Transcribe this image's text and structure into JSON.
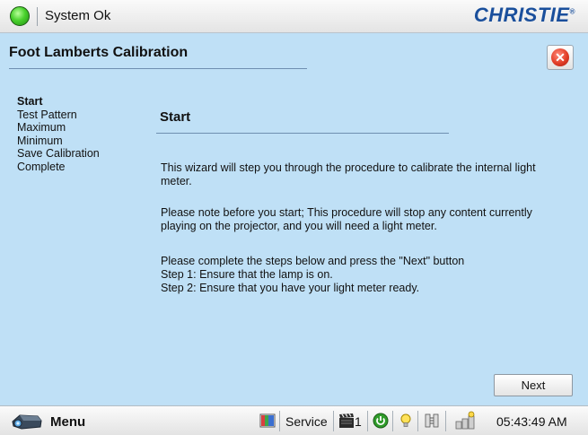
{
  "status": {
    "text": "System Ok",
    "indicator_color": "#3cc421"
  },
  "brand": {
    "name": "CHRISTIE",
    "mark": "®",
    "color": "#1a4f9c"
  },
  "page": {
    "title": "Foot Lamberts Calibration",
    "close_icon": "close-circle-icon"
  },
  "steps": [
    {
      "label": "Start",
      "active": true
    },
    {
      "label": "Test Pattern",
      "active": false
    },
    {
      "label": "Maximum",
      "active": false
    },
    {
      "label": "Minimum",
      "active": false
    },
    {
      "label": "Save Calibration",
      "active": false
    },
    {
      "label": "Complete",
      "active": false
    }
  ],
  "content": {
    "section_title": "Start",
    "paragraph1": "This wizard will step you through the procedure to calibrate the internal light meter.",
    "paragraph2": "Please note before you start; This procedure will stop any content currently playing on the projector, and you will need a light meter.",
    "paragraph3_line1": "Please complete the steps below and press the \"Next\" button",
    "paragraph3_line2": "Step 1: Ensure that the lamp is on.",
    "paragraph3_line3": "Step 2: Ensure that you have your light meter ready."
  },
  "buttons": {
    "next_label": "Next"
  },
  "taskbar": {
    "menu_label": "Menu",
    "service_label": "Service",
    "channel_number": "1",
    "clock": "05:43:49 AM",
    "icons": [
      "projector-icon",
      "test-pattern-icon",
      "clapperboard-icon",
      "power-icon",
      "lamp-icon",
      "network-icon",
      "server-icon"
    ]
  },
  "colors": {
    "background": "#bfe0f6",
    "accent": "#1a4f9c"
  }
}
